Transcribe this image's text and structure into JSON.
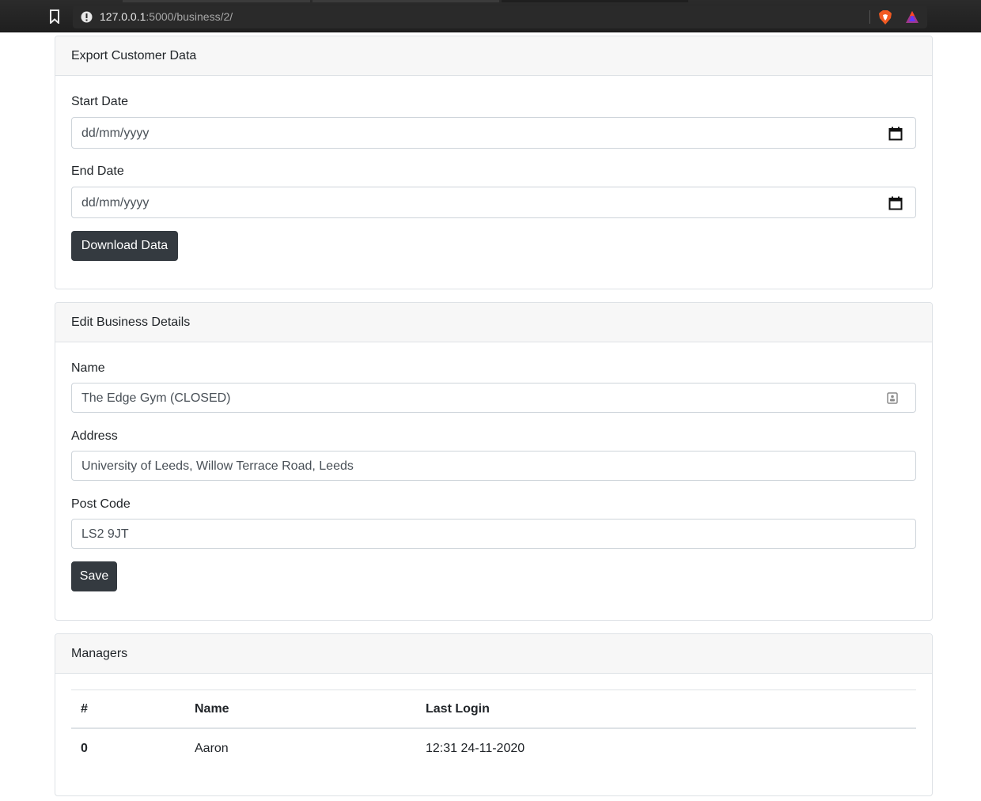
{
  "browser": {
    "url_host": "127.0.0.1",
    "url_path": ":5000/business/2/"
  },
  "export_card": {
    "title": "Export Customer Data",
    "start_label": "Start Date",
    "start_placeholder": "dd/mm/yyyy",
    "end_label": "End Date",
    "end_placeholder": "dd/mm/yyyy",
    "download_label": "Download Data"
  },
  "edit_card": {
    "title": "Edit Business Details",
    "name_label": "Name",
    "name_value": "The Edge Gym (CLOSED)",
    "address_label": "Address",
    "address_value": "University of Leeds, Willow Terrace Road, Leeds",
    "postcode_label": "Post Code",
    "postcode_value": "LS2 9JT",
    "save_label": "Save"
  },
  "managers_card": {
    "title": "Managers",
    "columns": [
      "#",
      "Name",
      "Last Login"
    ],
    "rows": [
      {
        "index": "0",
        "name": "Aaron",
        "last_login": "12:31 24-11-2020"
      }
    ]
  },
  "colors": {
    "button_bg": "#343a40",
    "card_header_bg": "#f7f7f7",
    "border": "#dee2e6",
    "brave_orange": "#f15a22"
  },
  "icons": [
    "bookmark-icon",
    "info-icon",
    "brave-shield-icon",
    "brave-rewards-icon",
    "calendar-icon",
    "contact-card-icon"
  ]
}
